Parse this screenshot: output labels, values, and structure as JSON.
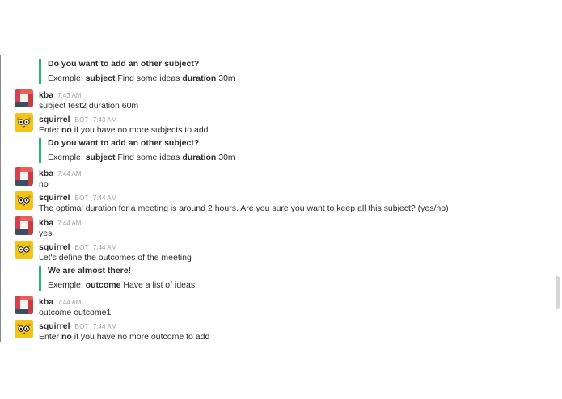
{
  "messages": [
    {
      "kind": "attachment",
      "title": "Do you want to add an other subject?",
      "parts": [
        "Exemple: ",
        "subject",
        " Find some ideas ",
        "duration",
        " 30m"
      ]
    },
    {
      "kind": "message",
      "user": "kba",
      "bot": "",
      "time": "7:43 AM",
      "parts": [
        "subject test2 duration 60m"
      ]
    },
    {
      "kind": "message",
      "user": "squirrel",
      "bot": "BOT",
      "time": "7:43 AM",
      "parts": [
        "Enter ",
        "no",
        " if you have no more subjects to add"
      ]
    },
    {
      "kind": "attachment",
      "title": "Do you want to add an other subject?",
      "parts": [
        "Exemple: ",
        "subject",
        " Find some ideas ",
        "duration",
        " 30m"
      ]
    },
    {
      "kind": "message",
      "user": "kba",
      "bot": "",
      "time": "7:44 AM",
      "parts": [
        "no"
      ]
    },
    {
      "kind": "message",
      "user": "squirrel",
      "bot": "BOT",
      "time": "7:44 AM",
      "parts": [
        "The optimal duration for a meeting is around 2 hours. Are you sure you want to keep all this subject? (yes/no)"
      ]
    },
    {
      "kind": "message",
      "user": "kba",
      "bot": "",
      "time": "7:44 AM",
      "parts": [
        "yes"
      ]
    },
    {
      "kind": "message",
      "user": "squirrel",
      "bot": "BOT",
      "time": "7:44 AM",
      "parts": [
        "Let's define the outcomes of the meeting"
      ]
    },
    {
      "kind": "attachment",
      "title": "We are almost there!",
      "parts": [
        "Exemple: ",
        "outcome",
        " Have a list of ideas!"
      ]
    },
    {
      "kind": "message",
      "user": "kba",
      "bot": "",
      "time": "7:44 AM",
      "parts": [
        "outcome outcome1"
      ]
    },
    {
      "kind": "message",
      "user": "squirrel",
      "bot": "BOT",
      "time": "7:44 AM",
      "parts": [
        "Enter ",
        "no",
        " if you have no more outcome to add"
      ]
    }
  ],
  "colors": {
    "attachment_bar": "#2ab27b",
    "bot_avatar": "#f2c318",
    "kba_avatar_accent": "#d9404d"
  },
  "icons": {
    "kba": "patchwork-avatar",
    "squirrel": "squirrel-bot-avatar"
  }
}
